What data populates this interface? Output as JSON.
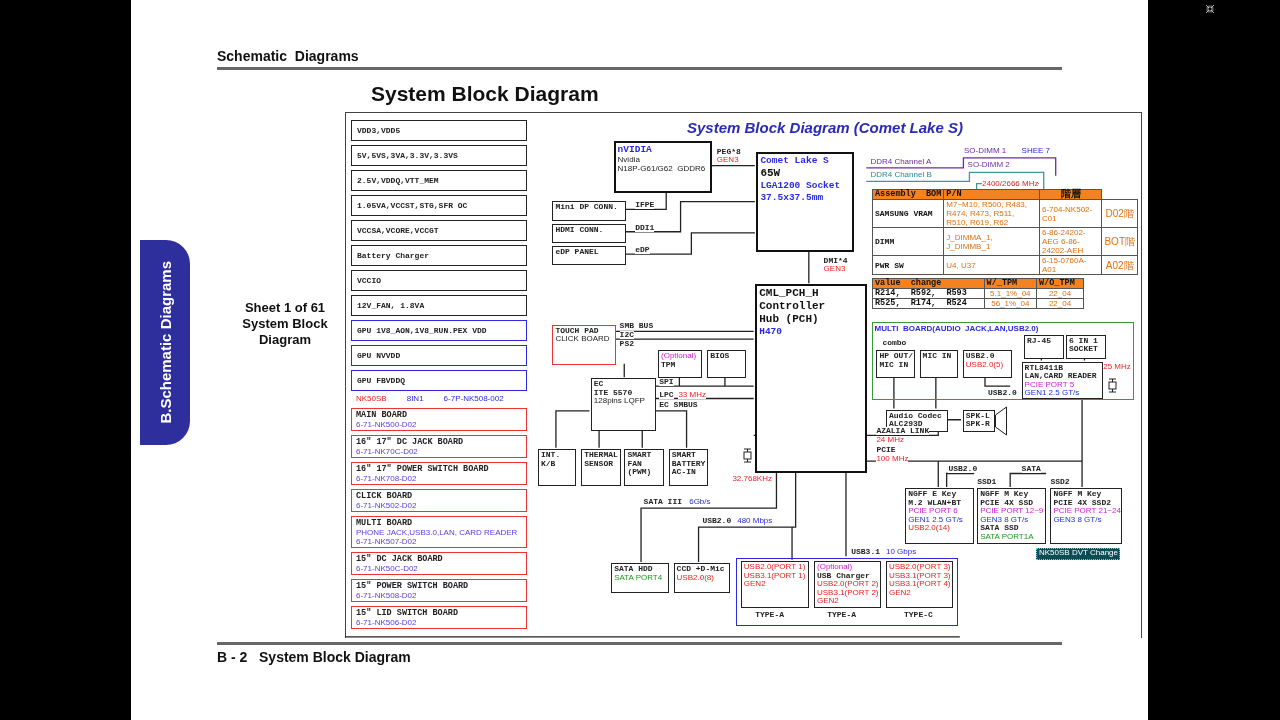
{
  "viewer": {
    "page_header": "Schematic  Diagrams",
    "page_title": "System Block Diagram",
    "side_tab": "B.Schematic Diagrams",
    "sheet_info": [
      "Sheet 1 of 61",
      "System Block",
      "Diagram"
    ],
    "footer": "B - 2   System Block Diagram"
  },
  "diagram": {
    "title": "System Block Diagram (Comet Lake S)",
    "power_rails": [
      {
        "label": "VDD3,VDD5",
        "kind": "system"
      },
      {
        "label": "5V,5VS,3VA,3.3V,3.3VS",
        "kind": "system"
      },
      {
        "label": "2.5V,VDDQ,VTT_MEM",
        "kind": "system"
      },
      {
        "label": "1.05VA,VCCST,STG,SFR OC",
        "kind": "system"
      },
      {
        "label": "VCCSA,VCORE,VCCGT",
        "kind": "system"
      },
      {
        "label": "Battery Charger",
        "kind": "system"
      },
      {
        "label": "VCCIO",
        "kind": "system"
      },
      {
        "label": "12V_FAN, 1.8VA",
        "kind": "system"
      },
      {
        "label": "GPU 1V8_AON,1V8_RUN.PEX VDD",
        "kind": "gpu"
      },
      {
        "label": "GPU NVVDD",
        "kind": "gpu"
      },
      {
        "label": "GPU FBVDDQ",
        "kind": "gpu"
      }
    ],
    "board_set": [
      {
        "text": "NK50SB",
        "kind": "red"
      },
      {
        "text": "8IN1",
        "kind": "blue"
      },
      {
        "text": "6-7P-NK508-002",
        "kind": "blue"
      }
    ],
    "boards": [
      {
        "name": "MAIN BOARD",
        "part": "6-71-NK500-D02"
      },
      {
        "name": "16\" 17\" DC JACK BOARD",
        "part": "6-71-NK70C-D02"
      },
      {
        "name": "16\" 17\" POWER SWITCH BOARD",
        "part": "6-71-NK708-D02"
      },
      {
        "name": "CLICK BOARD",
        "part": "6-71-NK502-D02"
      },
      {
        "name": "MULTI BOARD",
        "note": "PHONE JACK,USB3.0,LAN, CARD READER",
        "part": "6-71-NK507-D02"
      },
      {
        "name": "15\" DC JACK BOARD",
        "part": "6-71-NK50C-D02"
      },
      {
        "name": "15\" POWER SWITCH BOARD",
        "part": "6-71-NK508-D02"
      },
      {
        "name": "15\" LID SWITCH BOARD",
        "part": "6-71-NK506-D02"
      }
    ],
    "blocks": [
      {
        "kind": "thick",
        "lines": [
          {
            "text": "nVIDIA",
            "kind": "head"
          },
          {
            "text": "Nvidia",
            "kind": "small"
          },
          {
            "text": "N18P-G61/G62  GDDR6",
            "kind": "small"
          }
        ]
      },
      {
        "kind": "thick",
        "lines": [
          {
            "text": "Comet Lake S",
            "kind": "head"
          },
          {
            "text": "65W",
            "kind": "big"
          },
          {
            "text": "LGA1200 Socket",
            "kind": "head"
          },
          {
            "text": "37.5x37.5mm",
            "kind": "head"
          }
        ]
      },
      {
        "kind": "thin",
        "lines": [
          {
            "text": "Mini DP CONN.",
            "kind": "text"
          }
        ]
      },
      {
        "kind": "thin",
        "lines": [
          {
            "text": "HDMI CONN.",
            "kind": "text"
          }
        ]
      },
      {
        "kind": "thin",
        "lines": [
          {
            "text": "eDP PANEL",
            "kind": "text"
          }
        ]
      },
      {
        "kind": "thick",
        "lines": [
          {
            "text": "CML_PCH_H",
            "kind": "big"
          },
          {
            "text": "Controller",
            "kind": "big"
          },
          {
            "text": "Hub (PCH)",
            "kind": "big"
          },
          {
            "text": "H470",
            "kind": "head"
          }
        ]
      },
      {
        "kind": "red",
        "lines": [
          {
            "text": "TOUCH PAD",
            "kind": "text"
          },
          {
            "text": "CLICK BOARD",
            "kind": "small"
          }
        ]
      },
      {
        "kind": "thin",
        "lines": [
          {
            "text": "(Optional)",
            "kind": "magenta"
          },
          {
            "text": "TPM",
            "kind": "text"
          }
        ]
      },
      {
        "kind": "thin",
        "lines": [
          {
            "text": "BIOS",
            "kind": "text"
          }
        ]
      },
      {
        "kind": "thin",
        "lines": [
          {
            "text": "EC",
            "kind": "text"
          },
          {
            "text": "ITE 5570",
            "kind": "text"
          },
          {
            "text": "128pins LQFP",
            "kind": "small"
          }
        ]
      },
      {
        "kind": "thin",
        "lines": [
          {
            "text": "INT.",
            "kind": "text"
          },
          {
            "text": "K/B",
            "kind": "text"
          }
        ]
      },
      {
        "kind": "thin",
        "lines": [
          {
            "text": "THERMAL",
            "kind": "text"
          },
          {
            "text": "SENSOR",
            "kind": "text"
          }
        ]
      },
      {
        "kind": "thin",
        "lines": [
          {
            "text": "SMART",
            "kind": "text"
          },
          {
            "text": "FAN",
            "kind": "text"
          },
          {
            "text": "(PWM)",
            "kind": "text"
          }
        ]
      },
      {
        "kind": "thin",
        "lines": [
          {
            "text": "SMART",
            "kind": "text"
          },
          {
            "text": "BATTERY",
            "kind": "text"
          },
          {
            "text": "AC-IN",
            "kind": "text"
          }
        ]
      },
      {
        "kind": "group-green",
        "lines": [
          {
            "text": "MULTI  BOARD(AUDIO  JACK,LAN,USB2.0)",
            "kind": "blue"
          }
        ]
      },
      {
        "kind": "thin",
        "lines": [
          {
            "text": "HP OUT/",
            "kind": "text"
          },
          {
            "text": "MIC IN",
            "kind": "text"
          }
        ]
      },
      {
        "kind": "thin",
        "lines": [
          {
            "text": "MIC IN",
            "kind": "text"
          }
        ]
      },
      {
        "kind": "thin",
        "lines": [
          {
            "text": "USB2.0",
            "kind": "text"
          },
          {
            "text": "USB2.0(5)",
            "kind": "red"
          }
        ]
      },
      {
        "kind": "thin",
        "lines": [
          {
            "text": "RJ-45",
            "kind": "text"
          }
        ]
      },
      {
        "kind": "thin",
        "lines": [
          {
            "text": "6 IN 1",
            "kind": "text"
          },
          {
            "text": "SOCKET",
            "kind": "text"
          }
        ]
      },
      {
        "kind": "thin",
        "lines": [
          {
            "text": "RTL8411B",
            "kind": "text"
          },
          {
            "text": "LAN,CARD READER",
            "kind": "text"
          },
          {
            "text": "PCIE PORT 5",
            "kind": "magenta"
          },
          {
            "text": "GEN1 2.5 GT/s",
            "kind": "blue"
          }
        ]
      },
      {
        "kind": "thin",
        "lines": [
          {
            "text": "Audio Codec",
            "kind": "text"
          },
          {
            "text": "ALC293D",
            "kind": "text"
          }
        ]
      },
      {
        "kind": "thin",
        "lines": [
          {
            "text": "SPK-L",
            "kind": "text"
          },
          {
            "text": "SPK-R",
            "kind": "text"
          }
        ]
      },
      {
        "kind": "thin",
        "lines": [
          {
            "text": "NGFF E Key",
            "kind": "text"
          },
          {
            "text": "M.2 WLAN+BT",
            "kind": "text"
          },
          {
            "text": "PCIE PORT 6",
            "kind": "magenta"
          },
          {
            "text": "GEN1 2.5 GT/s",
            "kind": "blue"
          },
          {
            "text": "USB2.0(14)",
            "kind": "red"
          }
        ]
      },
      {
        "kind": "thin",
        "lines": [
          {
            "text": "NGFF M Key",
            "kind": "text"
          },
          {
            "text": "PCIE 4X SSD",
            "kind": "text"
          },
          {
            "text": "PCIE PORT 12~9",
            "kind": "magenta"
          },
          {
            "text": "GEN3 8 GT/s",
            "kind": "blue"
          },
          {
            "text": "SATA SSD",
            "kind": "text"
          },
          {
            "text": "SATA PORT1A",
            "kind": "green"
          }
        ]
      },
      {
        "kind": "thin",
        "lines": [
          {
            "text": "NGFF M Key",
            "kind": "text"
          },
          {
            "text": "PCIE 4X SSD2",
            "kind": "text"
          },
          {
            "text": "PCIE PORT 21~24",
            "kind": "magenta"
          },
          {
            "text": "GEN3 8 GT/s",
            "kind": "blue"
          }
        ]
      },
      {
        "kind": "badge",
        "lines": [
          {
            "text": "NK50SB DVT Change",
            "kind": "small"
          }
        ]
      },
      {
        "kind": "thin",
        "lines": [
          {
            "text": "SATA HDD",
            "kind": "text"
          },
          {
            "text": "SATA PORT4",
            "kind": "green"
          }
        ]
      },
      {
        "kind": "thin",
        "lines": [
          {
            "text": "CCD +D-Mic",
            "kind": "text"
          },
          {
            "text": "USB2.0(8)",
            "kind": "red"
          }
        ]
      },
      {
        "kind": "group-blue"
      },
      {
        "kind": "thin",
        "lines": [
          {
            "text": "USB2.0(PORT 1)",
            "kind": "red"
          },
          {
            "text": "USB3.1(PORT 1)",
            "kind": "red"
          },
          {
            "text": "GEN2",
            "kind": "red"
          }
        ]
      },
      {
        "kind": "thin",
        "lines": [
          {
            "text": "(Optional)",
            "kind": "magenta"
          },
          {
            "text": "USB Charger",
            "kind": "text"
          },
          {
            "text": "USB2.0(PORT 2)",
            "kind": "red"
          },
          {
            "text": "USB3.1(PORT 2)",
            "kind": "red"
          },
          {
            "text": "GEN2",
            "kind": "red"
          }
        ]
      },
      {
        "kind": "thin",
        "lines": [
          {
            "text": "USB2.0(PORT 3)",
            "kind": "red"
          },
          {
            "text": "USB3.1(PORT 3)",
            "kind": "red"
          },
          {
            "text": "USB3.1(PORT 4)",
            "kind": "red"
          },
          {
            "text": "GEN2",
            "kind": "red"
          }
        ]
      }
    ],
    "labels": [
      {
        "text": "PEG*8",
        "kind": "text"
      },
      {
        "text": "SO-DIMM 1",
        "kind": "purple"
      },
      {
        "text": "SHEE 7",
        "kind": "blue"
      },
      {
        "text": "GEN3",
        "kind": "red"
      },
      {
        "text": "DDR4 Channel A",
        "kind": "purple"
      },
      {
        "text": "SO-DIMM 2",
        "kind": "purple"
      },
      {
        "text": "DDR4 Channel B",
        "kind": "teal"
      },
      {
        "text": "2400/2666 MHz",
        "kind": "red"
      },
      {
        "text": "IFPE",
        "kind": "text"
      },
      {
        "text": "DDI1",
        "kind": "text"
      },
      {
        "text": "eDP",
        "kind": "text"
      },
      {
        "text": "DMI*4",
        "kind": "text"
      },
      {
        "text": "GEN3",
        "kind": "red"
      },
      {
        "text": "SMB BUS",
        "kind": "text"
      },
      {
        "text": "I2C",
        "kind": "text"
      },
      {
        "text": "combo",
        "kind": "text"
      },
      {
        "text": "PS2",
        "kind": "text"
      },
      {
        "text": "25 MHz",
        "kind": "red"
      },
      {
        "text": "SPI",
        "kind": "text"
      },
      {
        "text": "USB2.0",
        "kind": "text"
      },
      {
        "text": "LPC",
        "kind": "text"
      },
      {
        "text": "33 MHz",
        "kind": "red"
      },
      {
        "text": "EC SMBUS",
        "kind": "text"
      },
      {
        "text": "AZALIA LINK",
        "kind": "text"
      },
      {
        "text": "24 MHz",
        "kind": "red"
      },
      {
        "text": "PCIE",
        "kind": "text"
      },
      {
        "text": "100 MHz",
        "kind": "red"
      },
      {
        "text": "USB2.0",
        "kind": "text"
      },
      {
        "text": "SATA",
        "kind": "text"
      },
      {
        "text": "32.768KHz",
        "kind": "red"
      },
      {
        "text": "SSD1",
        "kind": "text"
      },
      {
        "text": "SSD2",
        "kind": "text"
      },
      {
        "text": "SATA III",
        "kind": "text"
      },
      {
        "text": "6Gb/s",
        "kind": "blue"
      },
      {
        "text": "USB2.0",
        "kind": "text"
      },
      {
        "text": "480 Mbps",
        "kind": "blue"
      },
      {
        "text": "USB3.1",
        "kind": "text"
      },
      {
        "text": "10 Gbps",
        "kind": "blue"
      },
      {
        "text": "TYPE-A",
        "kind": "text"
      },
      {
        "text": "TYPE-A",
        "kind": "text"
      },
      {
        "text": "TYPE-C",
        "kind": "text"
      }
    ],
    "bom": {
      "columns": [
        "Assembly  BOM",
        "P/N",
        "階層"
      ],
      "rows": [
        [
          "SAMSUNG VRAM",
          "M7~M10, R500, R483, R474, R473, R511, R510, R619, R62",
          "6-704-NK502-C01",
          "D02階"
        ],
        [
          "DIMM",
          "J_DIMMA_1, J_DIMMB_1",
          "6-86-24202-AEG 6-86-24202-AEH",
          "BOT階"
        ],
        [
          "PWR SW",
          "U4, U37",
          "6-15-0760A-A01",
          "A02階"
        ]
      ]
    },
    "value_change": {
      "columns": [
        "value  change",
        "W/_TPM",
        "W/O_TPM"
      ],
      "rows": [
        [
          "R214,  R592,  R593",
          "5.1_1%_04",
          "22_04"
        ],
        [
          "R525,  R174,  R524",
          "56_1%_04",
          "22_04"
        ]
      ]
    }
  }
}
